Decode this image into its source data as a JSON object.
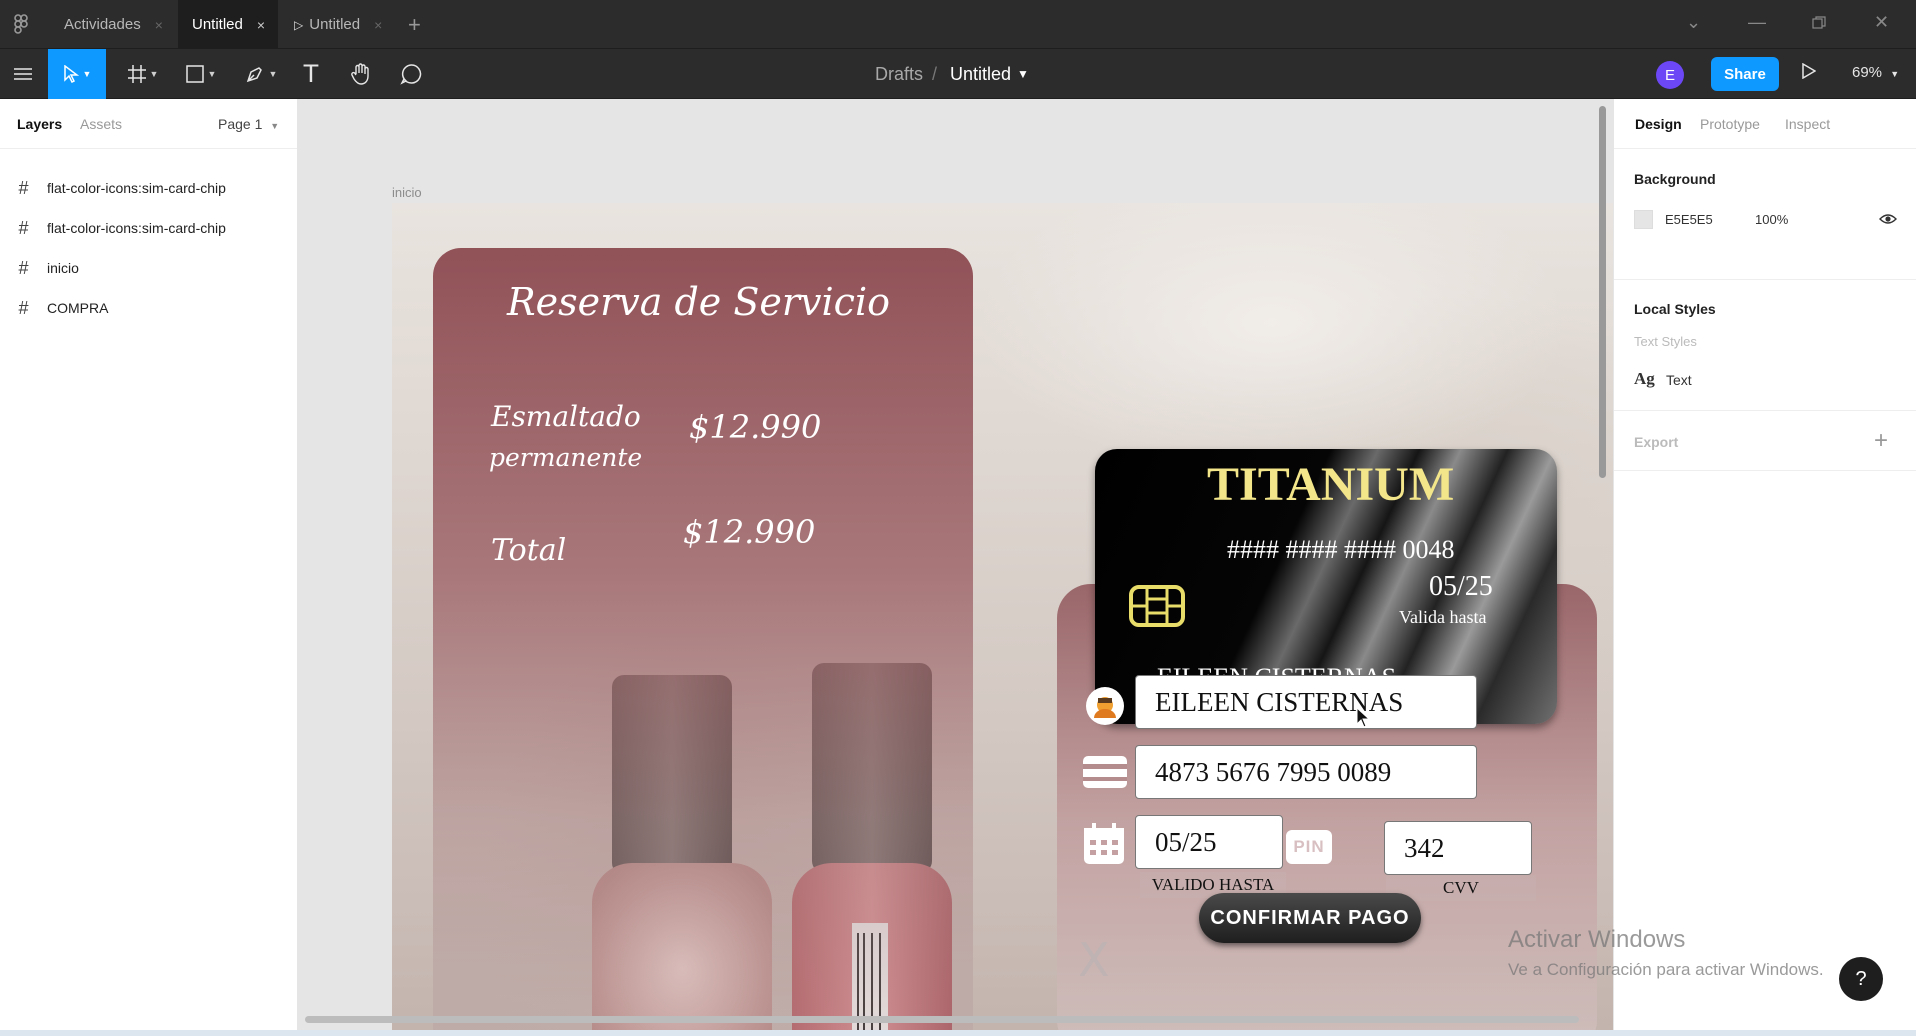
{
  "titlebar": {
    "tabs": [
      {
        "label": "Actividades",
        "close": "×"
      },
      {
        "label": "Untitled",
        "close": "×"
      },
      {
        "label": "Untitled",
        "close": "×"
      }
    ],
    "play_glyph": "▷",
    "add_tab": "+"
  },
  "toolbar": {
    "breadcrumb_root": "Drafts",
    "separator": "/",
    "file_name": "Untitled",
    "user_initial": "E",
    "share_label": "Share",
    "zoom": "69%"
  },
  "left_panel": {
    "tab_layers": "Layers",
    "tab_assets": "Assets",
    "page": "Page 1",
    "layers": [
      {
        "name": "flat-color-icons:sim-card-chip"
      },
      {
        "name": "flat-color-icons:sim-card-chip"
      },
      {
        "name": "inicio"
      },
      {
        "name": "COMPRA"
      }
    ]
  },
  "canvas": {
    "frame_label": "inicio",
    "service_card": {
      "title": "Reserva de Servicio",
      "item_line1": "Esmaltado",
      "item_line2": "permanente",
      "item_price": "$12.990",
      "total_label": "Total",
      "total_price": "$12.990"
    },
    "credit_card": {
      "brand": "TITANIUM",
      "number": "#### #### #### 0048",
      "expiry": "05/25",
      "expiry_caption": "Valida hasta",
      "holder": "EILEEN CISTERNAS"
    },
    "payment_form": {
      "name_value": "EILEEN CISTERNAS",
      "card_number_value": "4873 5676 7995 0089",
      "expiry_value": "05/25",
      "expiry_label": "VALIDO HASTA",
      "pin_label": "PIN",
      "cvv_value": "342",
      "cvv_label": "CVV",
      "confirm_label": "CONFIRMAR PAGO",
      "close_glyph": "X"
    }
  },
  "right_panel": {
    "tab_design": "Design",
    "tab_prototype": "Prototype",
    "tab_inspect": "Inspect",
    "background_heading": "Background",
    "background_hex": "E5E5E5",
    "background_opacity": "100%",
    "local_styles_heading": "Local Styles",
    "text_styles_label": "Text Styles",
    "text_style_sample": "Ag",
    "text_style_name": "Text",
    "export_heading": "Export",
    "export_add": "+"
  },
  "overlay": {
    "activate_title": "Activar Windows",
    "activate_sub": "Ve a Configuración para activar Windows.",
    "help": "?"
  },
  "colors": {
    "accent": "#0d99ff",
    "avatar": "#6b47f5",
    "canvas_bg": "#E5E5E5",
    "card_gold": "#f2e58a"
  }
}
